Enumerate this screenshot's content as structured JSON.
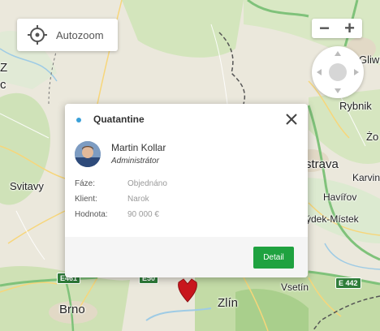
{
  "map": {
    "places": {
      "gliwice": "Gliwi",
      "rybnik": "Rybnik",
      "zory": "Żo",
      "ostrava": "strava",
      "karvina": "Karvin",
      "havirov": "Havířov",
      "frydek": "ýdek-Místek",
      "svitavy": "Svitavy",
      "zlin": "Zlín",
      "vsetin": "Vsetín",
      "brno": "Brno",
      "z_letter": "Z",
      "c_letter": "c"
    },
    "roads": {
      "e461": "E461",
      "e442": "E 442",
      "e50": "E50"
    },
    "marker_icon": "map-pin-marker-red"
  },
  "controls": {
    "autozoom_label": "Autozoom",
    "autozoom_icon": "crosshair-target-icon",
    "zoom_out_label": "−",
    "zoom_in_label": "+",
    "pan_icon": "pan-directional-icon"
  },
  "popup": {
    "status_color": "#3aa0d8",
    "title": "Quatantine",
    "close_icon": "close-icon",
    "user": {
      "name": "Martin Kollar",
      "role": "Administrátor"
    },
    "fields": [
      {
        "label": "Fáze:",
        "value": "Objednáno"
      },
      {
        "label": "Klient:",
        "value": "Narok"
      },
      {
        "label": "Hodnota:",
        "value": "90 000 €"
      }
    ],
    "detail_button": "Detail",
    "detail_color": "#1fa240"
  }
}
